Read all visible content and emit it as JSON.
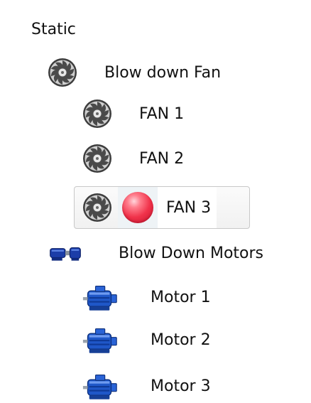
{
  "tree": {
    "items": [
      {
        "label": "Static",
        "status": "red",
        "icon": "none"
      },
      {
        "label": "Blow down Fan",
        "status": "red",
        "icon": "fan-icon"
      },
      {
        "label": "FAN 1",
        "status": "green",
        "icon": "fan-icon"
      },
      {
        "label": "FAN 2",
        "status": "green",
        "icon": "fan-icon"
      },
      {
        "label": "FAN 3",
        "status": "red",
        "icon": "fan-icon",
        "selected": true
      },
      {
        "label": "Blow Down Motors",
        "status": "green",
        "icon": "inline-motor-icon"
      },
      {
        "label": "Motor 1",
        "status": "green",
        "icon": "motor-icon"
      },
      {
        "label": "Motor 2",
        "status": "green",
        "icon": "motor-icon"
      },
      {
        "label": "Motor 3",
        "status": "green",
        "icon": "motor-icon"
      }
    ]
  },
  "colors": {
    "led_red": "#f0324a",
    "led_green": "#57c22d",
    "motor_blue": "#1f57c8"
  }
}
